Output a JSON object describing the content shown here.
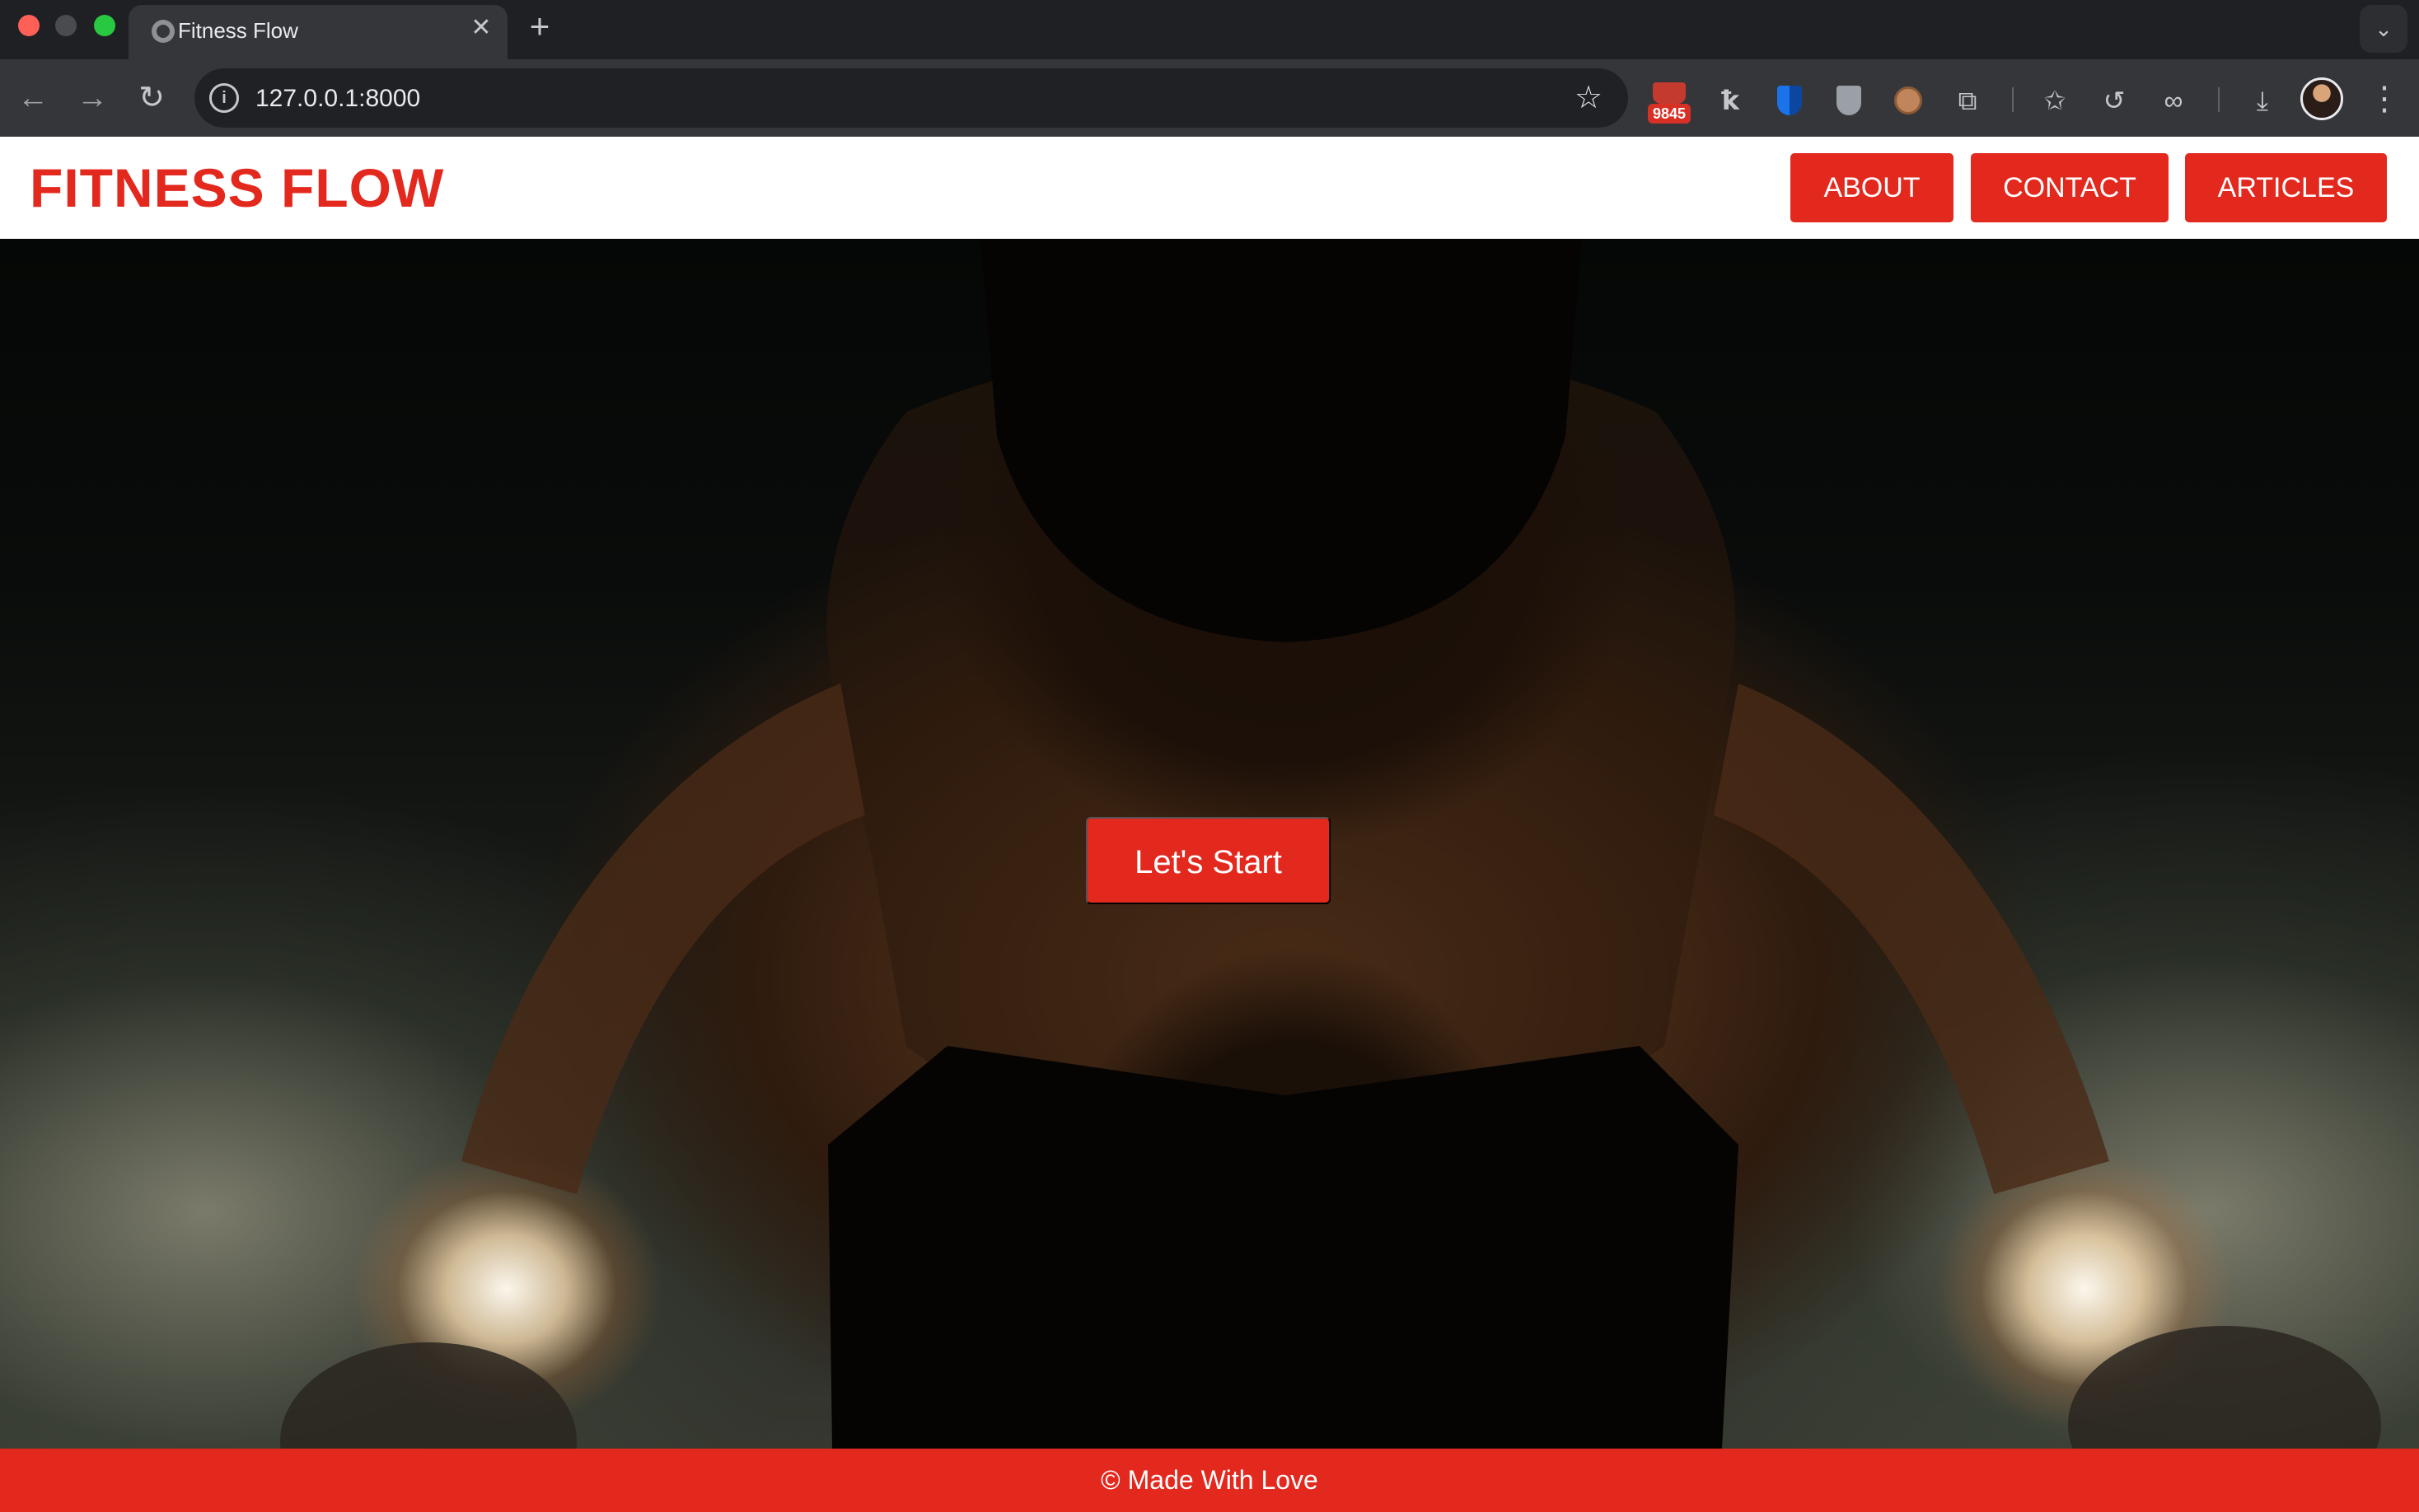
{
  "browser": {
    "tab": {
      "title": "Fitness Flow",
      "favicon_icon": "globe-icon",
      "close_icon": "close-icon"
    },
    "new_tab_icon": "plus-icon",
    "tab_search_icon": "chevron-down-icon",
    "url": "127.0.0.1:8000",
    "site_info_icon": "info-icon",
    "bookmark_icon": "star-icon",
    "extension_badge": "9845",
    "extensions": [
      "bucket-icon",
      "keyboard-icon",
      "shield-icon",
      "privacy-shield-icon",
      "cookie-icon",
      "puzzle-icon"
    ],
    "toolbar_icons": [
      "star-list-icon",
      "history-icon",
      "link-icon",
      "download-icon",
      "avatar",
      "more-menu-icon"
    ]
  },
  "site": {
    "logo": "FITNESS FLOW",
    "nav": [
      {
        "label": "ABOUT"
      },
      {
        "label": "CONTACT"
      },
      {
        "label": "ARTICLES"
      }
    ],
    "hero": {
      "cta_label": "Let's Start",
      "image": "hero-image"
    },
    "footer": {
      "text": "© Made With Love"
    },
    "colors": {
      "brand_red": "#e3281e",
      "header_bg": "#ffffff",
      "chrome_dark": "#1f2023",
      "chrome_toolbar": "#35363a"
    }
  }
}
